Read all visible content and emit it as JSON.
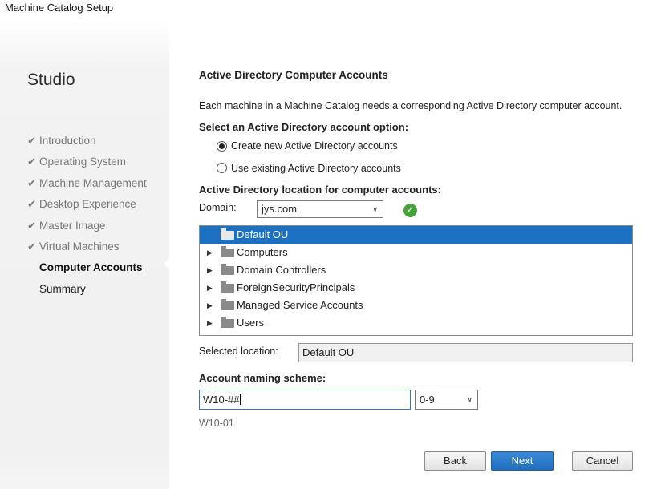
{
  "window": {
    "title": "Machine Catalog Setup"
  },
  "sidebar": {
    "brand": "Studio",
    "steps": [
      {
        "label": "Introduction",
        "state": "done"
      },
      {
        "label": "Operating System",
        "state": "done"
      },
      {
        "label": "Machine Management",
        "state": "done"
      },
      {
        "label": "Desktop Experience",
        "state": "done"
      },
      {
        "label": "Master Image",
        "state": "done"
      },
      {
        "label": "Virtual Machines",
        "state": "done"
      },
      {
        "label": "Computer Accounts",
        "state": "current"
      },
      {
        "label": "Summary",
        "state": "pending"
      }
    ],
    "check_glyph": "✔"
  },
  "main": {
    "title": "Active Directory Computer Accounts",
    "description": "Each machine in a Machine Catalog needs a corresponding Active Directory computer account.",
    "account_option_label": "Select an Active Directory account option:",
    "options": [
      {
        "label": "Create new Active Directory accounts",
        "selected": true
      },
      {
        "label": "Use existing Active Directory accounts",
        "selected": false
      }
    ],
    "location_label": "Active Directory location for computer accounts:",
    "domain_label": "Domain:",
    "domain_value": "jys.com",
    "domain_status_icon": "check-circle-icon",
    "tree": [
      {
        "label": "Default OU",
        "selected": true,
        "expandable": false
      },
      {
        "label": "Computers",
        "selected": false,
        "expandable": true
      },
      {
        "label": "Domain Controllers",
        "selected": false,
        "expandable": true
      },
      {
        "label": "ForeignSecurityPrincipals",
        "selected": false,
        "expandable": true
      },
      {
        "label": "Managed Service Accounts",
        "selected": false,
        "expandable": true
      },
      {
        "label": "Users",
        "selected": false,
        "expandable": true
      }
    ],
    "selected_location_label": "Selected location:",
    "selected_location_value": "Default OU",
    "naming_label": "Account naming scheme:",
    "naming_value": "W10-##",
    "naming_type": "0-9",
    "naming_preview": "W10-01"
  },
  "buttons": {
    "back": "Back",
    "next": "Next",
    "cancel": "Cancel"
  },
  "colors": {
    "selection": "#1c70c2",
    "ok": "#46a33a",
    "primary_button": "#2a7bcb"
  }
}
